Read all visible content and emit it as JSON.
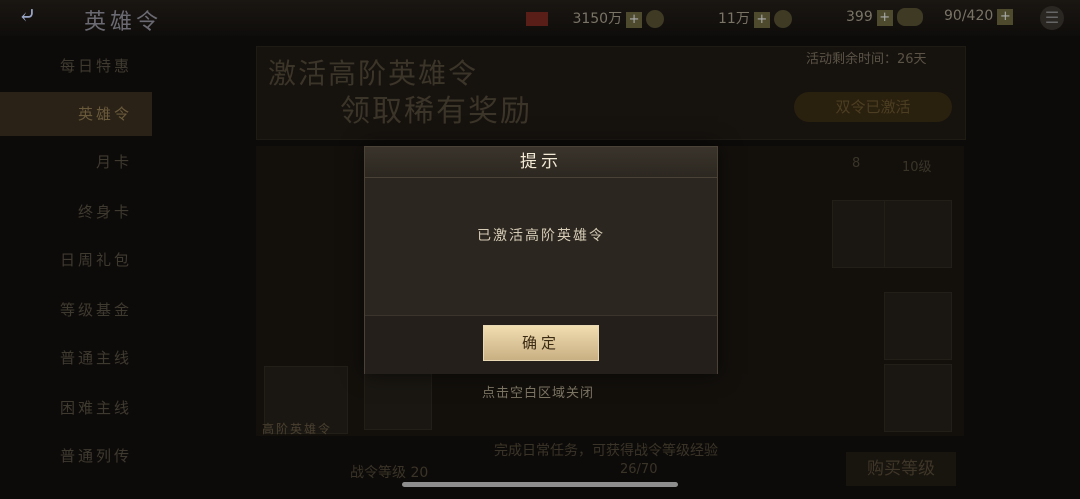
{
  "header": {
    "back_icon": "back-arrow-icon",
    "title": "英雄令",
    "resources": [
      {
        "value": "3150万",
        "icon": "gold-coin-icon"
      },
      {
        "value": "11万",
        "icon": "silver-coin-icon"
      },
      {
        "value": "399",
        "icon": "cloud-icon"
      },
      {
        "value": "90/420",
        "icon": "stamina-icon"
      }
    ],
    "plus_label": "+",
    "menu_icon": "menu-icon"
  },
  "sidebar": {
    "items": [
      {
        "label": "每日特惠"
      },
      {
        "label": "英雄令",
        "active": true
      },
      {
        "label": "月卡"
      },
      {
        "label": "终身卡"
      },
      {
        "label": "日周礼包"
      },
      {
        "label": "等级基金"
      },
      {
        "label": "普通主线"
      },
      {
        "label": "困难主线"
      },
      {
        "label": "普通列传"
      }
    ]
  },
  "banner": {
    "line1": "激活高阶英雄令",
    "line2": "领取稀有奖励",
    "remaining": "活动剩余时间：26天",
    "activated_label": "双令已激活"
  },
  "main": {
    "premium_label": "高阶英雄令",
    "level_text": "战令等级 20",
    "progress_text": "26/70",
    "hint_text": "完成日常任务，可获得战令等级经验",
    "buy_label": "购买等级",
    "column_labels": [
      "8",
      "10级"
    ]
  },
  "dialog": {
    "title": "提示",
    "message": "已激活高阶英雄令",
    "confirm_label": "确定",
    "close_hint": "点击空白区域关闭"
  }
}
